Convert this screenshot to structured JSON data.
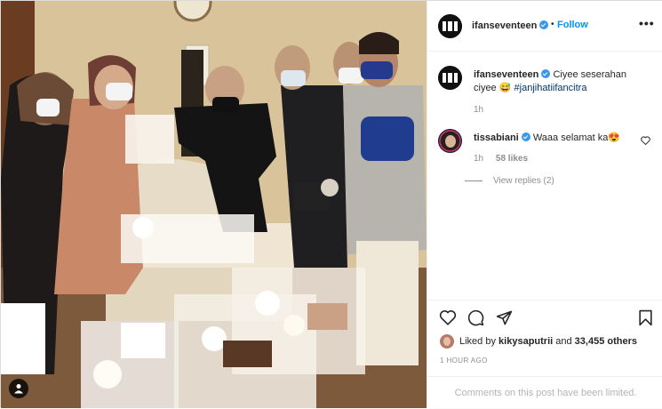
{
  "header": {
    "username": "ifanseventeen",
    "separator": "•",
    "follow_label": "Follow",
    "more_label": "•••"
  },
  "caption": {
    "username": "ifanseventeen",
    "text": "Ciyee seserahan ciyee",
    "emoji": "😅",
    "hashtag": "#janjihatiifancitra",
    "time": "1h"
  },
  "comment": {
    "username": "tissabiani",
    "text": "Waaa selamat ka",
    "emoji": "😍",
    "time": "1h",
    "likes": "58 likes",
    "view_replies": "View replies (2)"
  },
  "likes": {
    "prefix": "Liked by",
    "user": "kikysaputrii",
    "and": "and",
    "others": "33,455 others"
  },
  "timestamp": "1 HOUR AGO",
  "comments_limited": "Comments on this post have been limited.",
  "icons": {
    "verified": "verified-badge-icon",
    "like": "heart-icon",
    "comment": "comment-bubble-icon",
    "share": "paper-plane-icon",
    "save": "bookmark-icon",
    "user_tag": "person-tag-icon"
  },
  "colors": {
    "accent": "#0095f6",
    "verified": "#3897f0",
    "hashtag": "#00376b",
    "muted": "#8e8e8e"
  }
}
